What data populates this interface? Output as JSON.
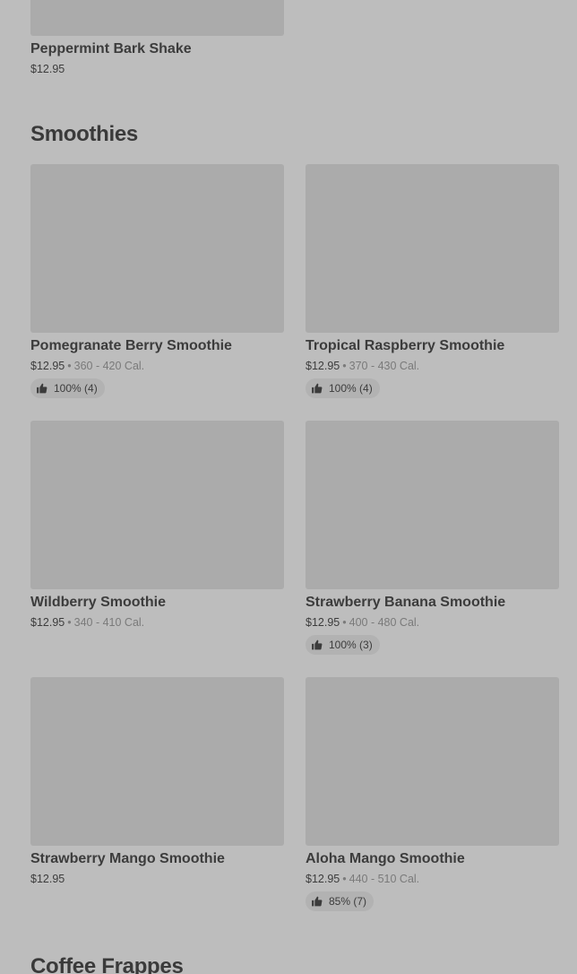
{
  "top_item": {
    "name": "Peppermint Bark Shake",
    "price": "$12.95"
  },
  "sections": [
    {
      "title": "Smoothies"
    },
    {
      "title": "Coffee Frappes"
    }
  ],
  "smoothies": [
    {
      "name": "Pomegranate Berry Smoothie",
      "price": "$12.95",
      "calories": "360 - 420 Cal.",
      "rating": "100% (4)"
    },
    {
      "name": "Tropical Raspberry Smoothie",
      "price": "$12.95",
      "calories": "370 - 430 Cal.",
      "rating": "100% (4)"
    },
    {
      "name": "Wildberry Smoothie",
      "price": "$12.95",
      "calories": "340 - 410 Cal.",
      "rating": ""
    },
    {
      "name": "Strawberry Banana Smoothie",
      "price": "$12.95",
      "calories": "400 - 480 Cal.",
      "rating": "100% (3)"
    },
    {
      "name": "Strawberry Mango Smoothie",
      "price": "$12.95",
      "calories": "",
      "rating": ""
    },
    {
      "name": "Aloha Mango Smoothie",
      "price": "$12.95",
      "calories": "440 - 510 Cal.",
      "rating": "85% (7)"
    }
  ],
  "separator": "•",
  "icons": {
    "rating": "thumbs-up-icon"
  }
}
